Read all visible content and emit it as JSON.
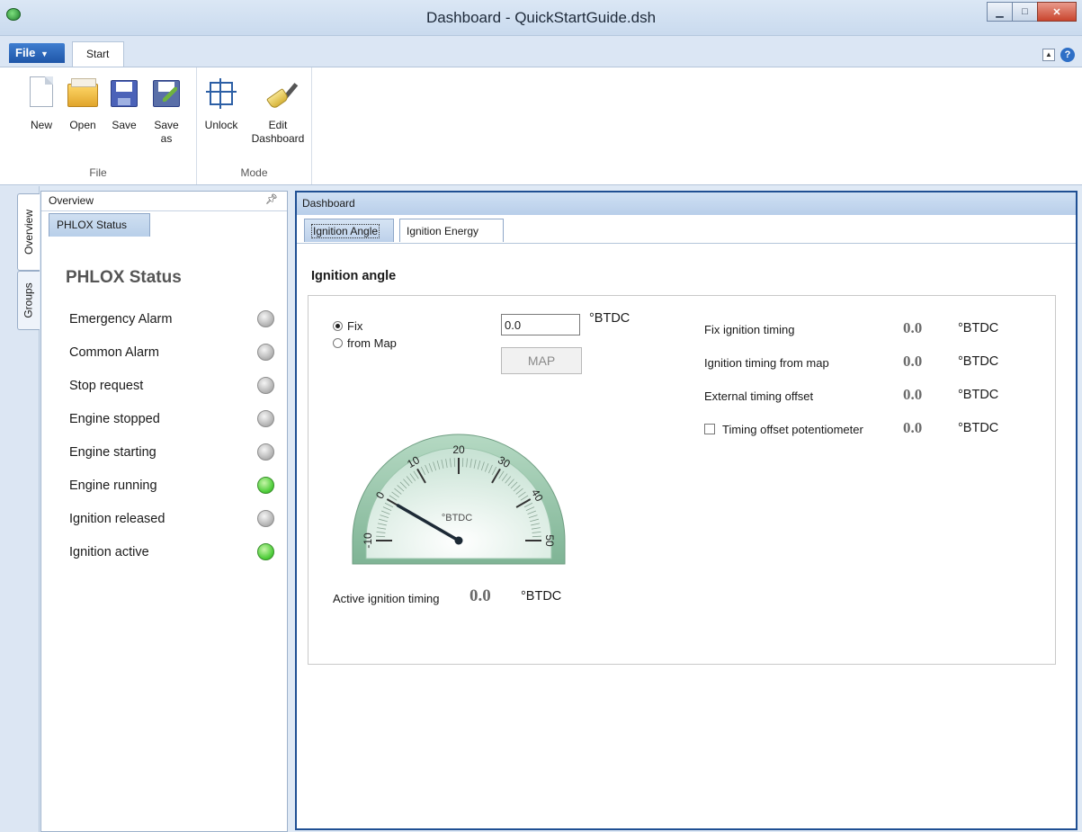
{
  "window": {
    "title": "Dashboard - QuickStartGuide.dsh"
  },
  "ribbon": {
    "file_tab": "File",
    "start_tab": "Start",
    "file_group": {
      "label": "File",
      "new": "New",
      "open": "Open",
      "save": "Save",
      "save_as_line1": "Save",
      "save_as_line2": "as"
    },
    "mode_group": {
      "label": "Mode",
      "unlock": "Unlock",
      "edit_line1": "Edit",
      "edit_line2": "Dashboard"
    }
  },
  "side_tabs": [
    "Overview",
    "Groups"
  ],
  "overview": {
    "header": "Overview",
    "tab": "PHLOX Status",
    "title": "PHLOX Status",
    "items": [
      {
        "label": "Emergency Alarm",
        "state": "gray"
      },
      {
        "label": "Common Alarm",
        "state": "gray"
      },
      {
        "label": "Stop request",
        "state": "gray"
      },
      {
        "label": "Engine stopped",
        "state": "gray"
      },
      {
        "label": "Engine starting",
        "state": "gray"
      },
      {
        "label": "Engine running",
        "state": "green"
      },
      {
        "label": "Ignition released",
        "state": "gray"
      },
      {
        "label": "Ignition active",
        "state": "green"
      }
    ]
  },
  "dashboard": {
    "header": "Dashboard",
    "tabs": [
      "Ignition Angle",
      "Ignition Energy"
    ],
    "section_title": "Ignition angle",
    "mode_fix": "Fix",
    "mode_map": "from Map",
    "fix_value": "0.0",
    "fix_unit": "°BTDC",
    "map_button": "MAP",
    "readouts": [
      {
        "label": "Fix ignition timing",
        "value": "0.0",
        "unit": "°BTDC"
      },
      {
        "label": "Ignition timing from map",
        "value": "0.0",
        "unit": "°BTDC"
      },
      {
        "label": "External timing offset",
        "value": "0.0",
        "unit": "°BTDC"
      },
      {
        "label": "Timing offset potentiometer",
        "value": "0.0",
        "unit": "°BTDC"
      }
    ],
    "gauge": {
      "unit_label": "°BTDC",
      "min": -10,
      "max": 50,
      "value": 0.0,
      "ticks": [
        "-10",
        "0",
        "10",
        "20",
        "30",
        "40",
        "50"
      ]
    },
    "active": {
      "label": "Active ignition timing",
      "value": "0.0",
      "unit": "°BTDC"
    }
  },
  "colors": {
    "led_green": "#4fce3b",
    "led_gray": "#b0b0b0",
    "dashboard_border": "#1f4f93",
    "file_tab": "#2a64b8"
  }
}
